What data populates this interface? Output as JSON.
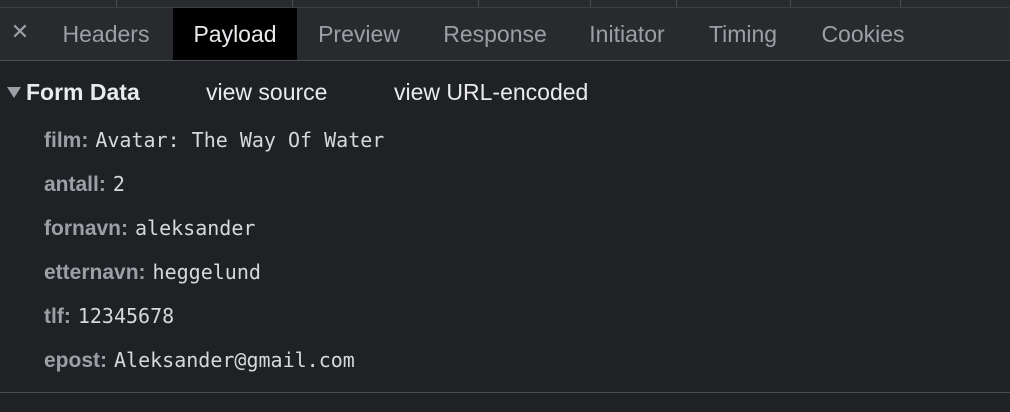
{
  "tabs": {
    "close_glyph": "✕",
    "items": [
      "Headers",
      "Payload",
      "Preview",
      "Response",
      "Initiator",
      "Timing",
      "Cookies"
    ],
    "active": "Payload"
  },
  "form_data": {
    "title": "Form Data",
    "view_source": "view source",
    "view_url_encoded": "view URL-encoded",
    "fields": [
      {
        "key": "film:",
        "value": "Avatar: The Way Of Water"
      },
      {
        "key": "antall:",
        "value": "2"
      },
      {
        "key": "fornavn:",
        "value": "aleksander"
      },
      {
        "key": "etternavn:",
        "value": "heggelund"
      },
      {
        "key": "tlf:",
        "value": "12345678"
      },
      {
        "key": "epost:",
        "value": "Aleksander@gmail.com"
      }
    ]
  },
  "colors": {
    "background": "#202124",
    "tabbar": "#292a2d",
    "active_tab": "#000000",
    "text": "#e8eaed",
    "muted": "#9aa0a6"
  }
}
